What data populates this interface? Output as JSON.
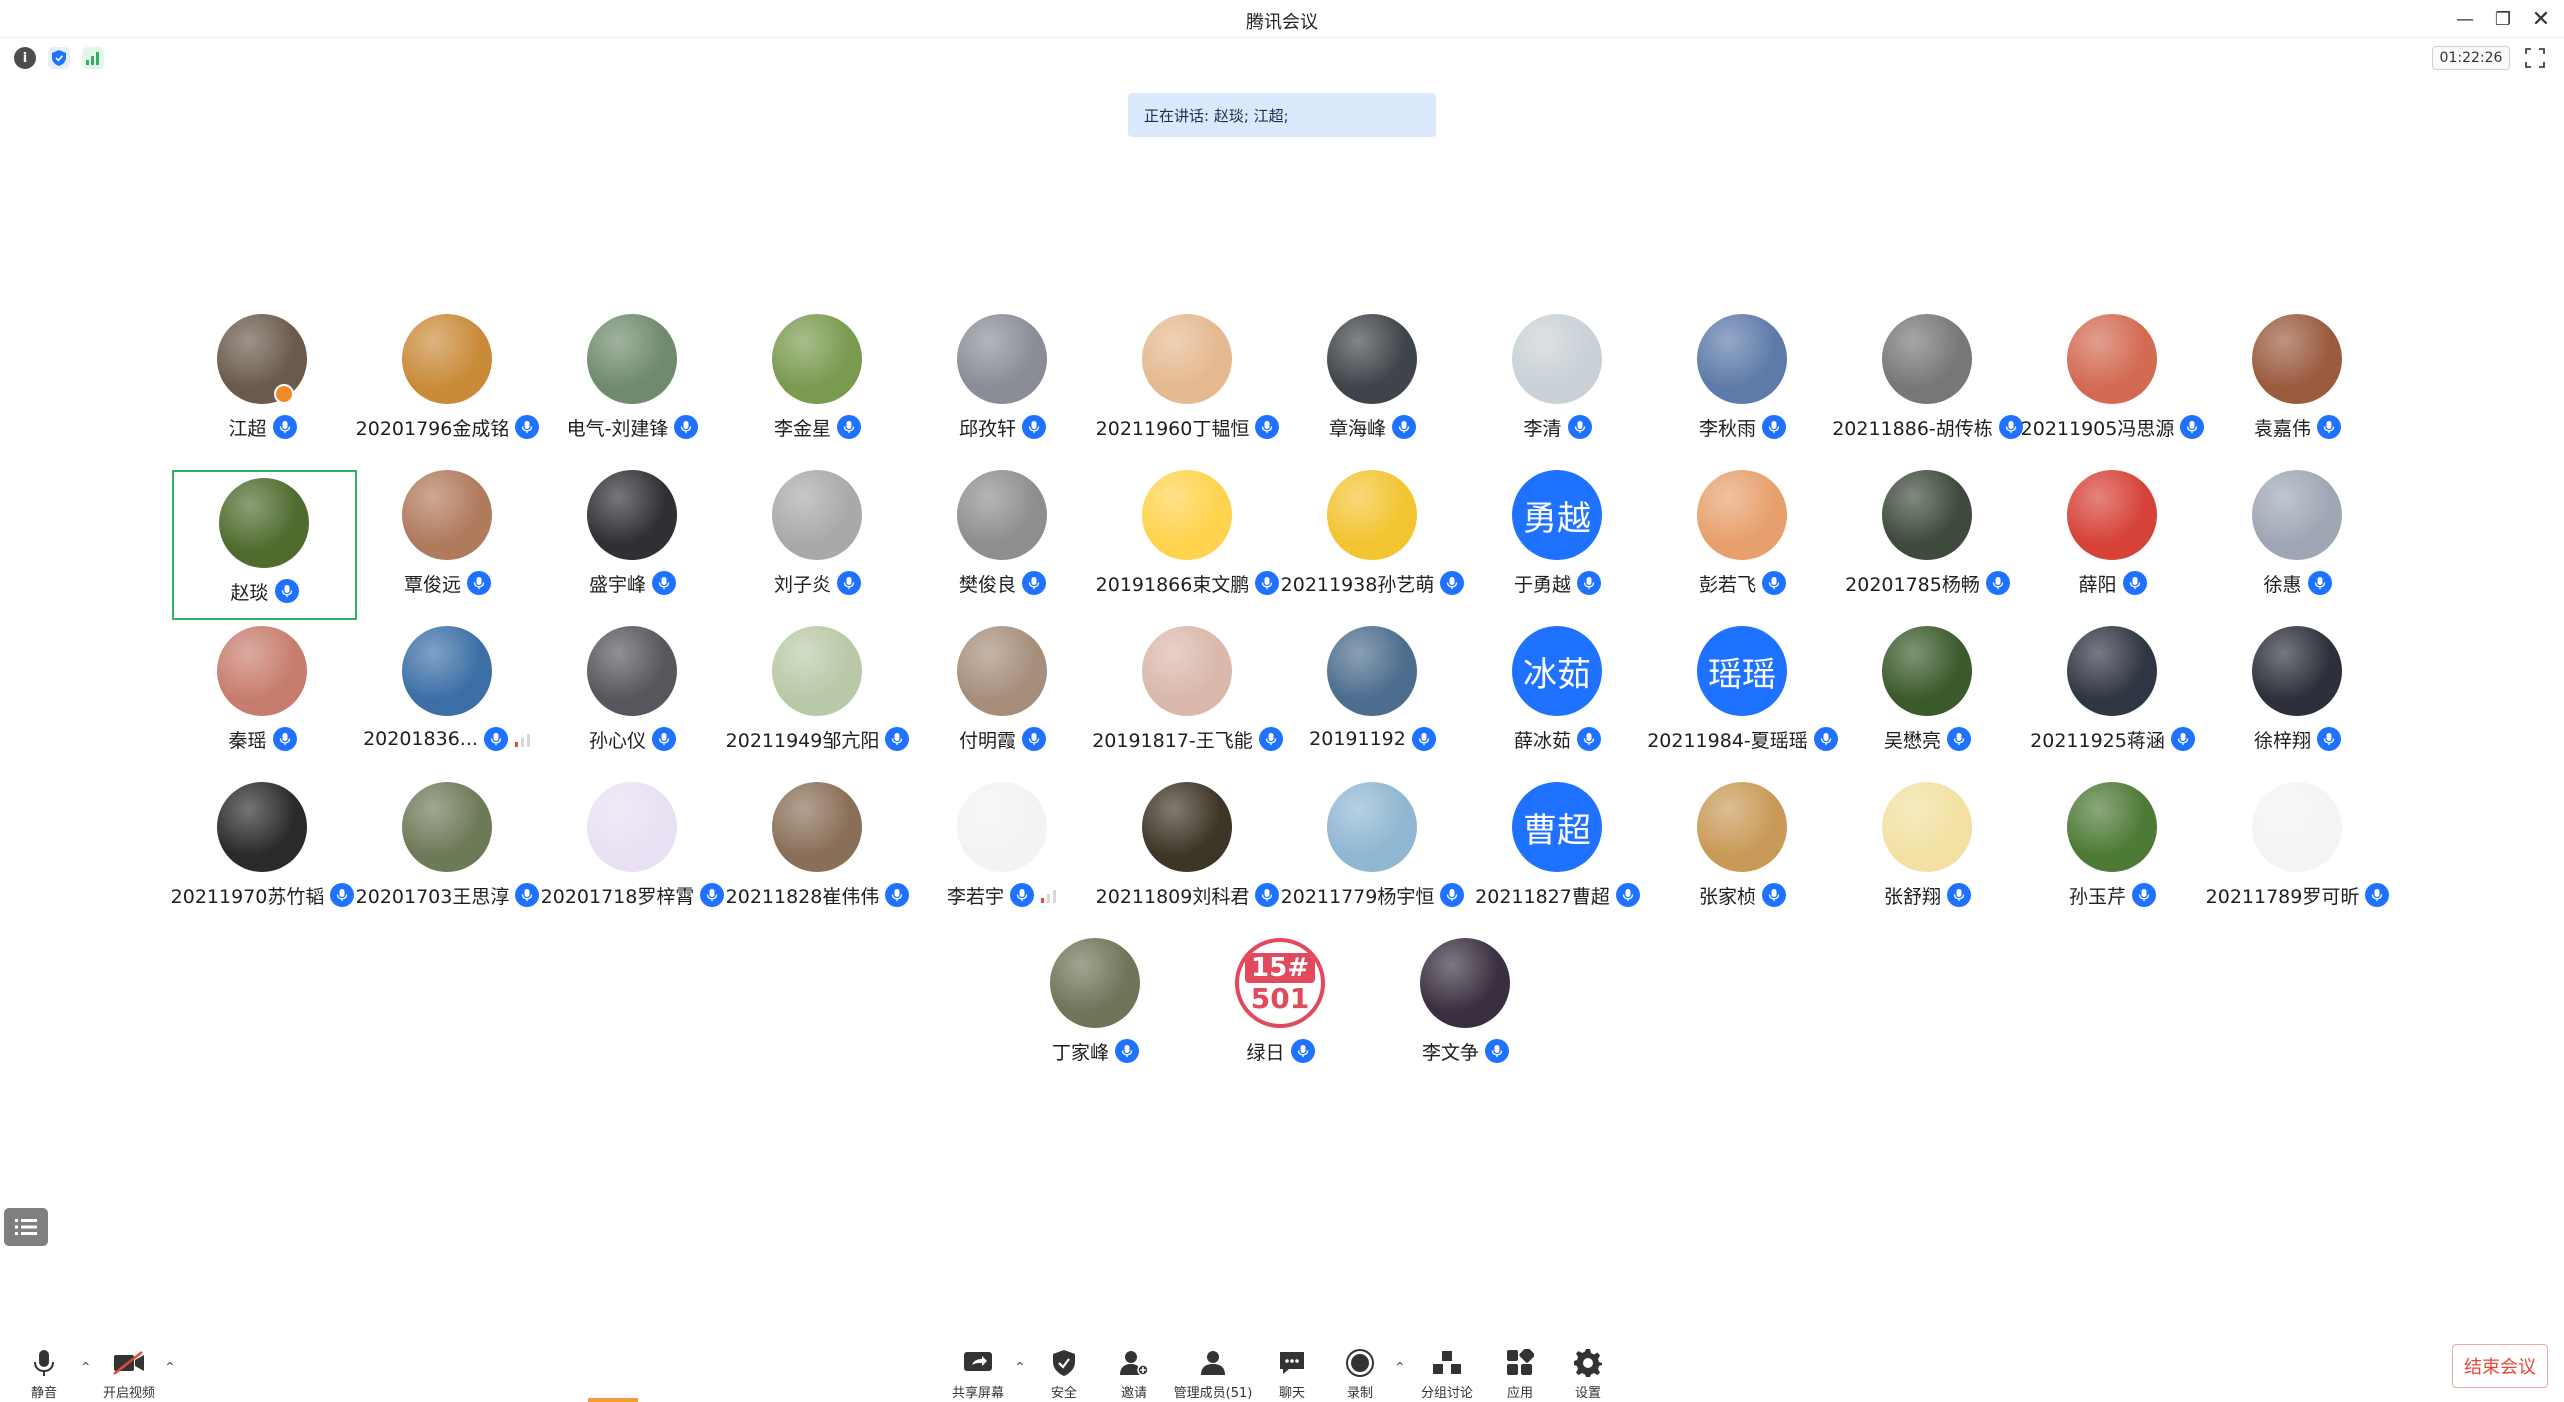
{
  "window": {
    "title": "腾讯会议",
    "minimize_icon": "minimize-icon",
    "restore_icon": "restore-icon",
    "close_icon": "close-icon"
  },
  "infobar": {
    "timer": "01:22:26"
  },
  "speaking_banner": "正在讲话: 赵琰; 江超;",
  "participants": [
    {
      "name": "江超",
      "avatar": "photo",
      "color": "#6a5a4c",
      "host": true
    },
    {
      "name": "20201796金成铭",
      "avatar": "photo",
      "color": "#c98b3a"
    },
    {
      "name": "电气-刘建锋",
      "avatar": "photo",
      "color": "#6f8a6c"
    },
    {
      "name": "李金星",
      "avatar": "photo",
      "color": "#7a9a4f"
    },
    {
      "name": "邱孜轩",
      "avatar": "photo",
      "color": "#8a8d96"
    },
    {
      "name": "20211960丁韫恒",
      "avatar": "photo",
      "color": "#e5b98f"
    },
    {
      "name": "章海峰",
      "avatar": "photo",
      "color": "#3f444a"
    },
    {
      "name": "李清",
      "avatar": "photo",
      "color": "#c9d1d6"
    },
    {
      "name": "李秋雨",
      "avatar": "photo",
      "color": "#5d7aa8"
    },
    {
      "name": "20211886-胡传栋",
      "avatar": "photo",
      "color": "#777777"
    },
    {
      "name": "20211905冯思源",
      "avatar": "photo",
      "color": "#d36a52"
    },
    {
      "name": "袁嘉伟",
      "avatar": "photo",
      "color": "#9a5b3e"
    },
    {
      "name": "赵琰",
      "avatar": "photo",
      "color": "#4f6b2d",
      "active": true
    },
    {
      "name": "覃俊远",
      "avatar": "photo",
      "color": "#b07a5c"
    },
    {
      "name": "盛宇峰",
      "avatar": "photo",
      "color": "#2f2f35"
    },
    {
      "name": "刘子炎",
      "avatar": "photo",
      "color": "#a9a9a9"
    },
    {
      "name": "樊俊良",
      "avatar": "photo",
      "color": "#8e8e8e"
    },
    {
      "name": "20191866束文鹏",
      "avatar": "photo",
      "color": "#ffd34d"
    },
    {
      "name": "20211938孙艺萌",
      "avatar": "photo",
      "color": "#f3c431"
    },
    {
      "name": "于勇越",
      "avatar": "text",
      "text": "勇越"
    },
    {
      "name": "彭若飞",
      "avatar": "photo",
      "color": "#e7a06d"
    },
    {
      "name": "20201785杨畅",
      "avatar": "photo",
      "color": "#3e4a3c"
    },
    {
      "name": "薛阳",
      "avatar": "photo",
      "color": "#d64238"
    },
    {
      "name": "徐惠",
      "avatar": "photo",
      "color": "#9fa7b5"
    },
    {
      "name": "秦瑶",
      "avatar": "photo",
      "color": "#c77d6d"
    },
    {
      "name": "20201836...",
      "avatar": "photo",
      "color": "#3c6fa6",
      "signal": true
    },
    {
      "name": "孙心仪",
      "avatar": "photo",
      "color": "#55575c"
    },
    {
      "name": "20211949邹亢阳",
      "avatar": "photo",
      "color": "#b9c9a7"
    },
    {
      "name": "付明霞",
      "avatar": "photo",
      "color": "#a68e7b"
    },
    {
      "name": "20191817-王飞能",
      "avatar": "photo",
      "color": "#d9b8ab"
    },
    {
      "name": "20191192",
      "avatar": "photo",
      "color": "#4c6d8e"
    },
    {
      "name": "薛冰茹",
      "avatar": "text",
      "text": "冰茹"
    },
    {
      "name": "20211984-夏瑶瑶",
      "avatar": "text",
      "text": "瑶瑶"
    },
    {
      "name": "吴懋亮",
      "avatar": "photo",
      "color": "#3b5a2b"
    },
    {
      "name": "20211925蒋涵",
      "avatar": "photo",
      "color": "#2f3542"
    },
    {
      "name": "徐梓翔",
      "avatar": "photo",
      "color": "#2d2f3a"
    },
    {
      "name": "20211970苏竹韬",
      "avatar": "photo",
      "color": "#2a2a2a"
    },
    {
      "name": "20201703王思淳",
      "avatar": "photo",
      "color": "#6d7a57"
    },
    {
      "name": "20201718罗梓霄",
      "avatar": "photo",
      "color": "#e9e1f3"
    },
    {
      "name": "20211828崔伟伟",
      "avatar": "photo",
      "color": "#8a6f58"
    },
    {
      "name": "李若宇",
      "avatar": "photo",
      "color": "#f3f3f3",
      "signal": true
    },
    {
      "name": "20211809刘科君",
      "avatar": "photo",
      "color": "#3d3526"
    },
    {
      "name": "20211779杨宇恒",
      "avatar": "photo",
      "color": "#8fb7d1"
    },
    {
      "name": "20211827曹超",
      "avatar": "text",
      "text": "曹超"
    },
    {
      "name": "张家桢",
      "avatar": "photo",
      "color": "#c99a57"
    },
    {
      "name": "张舒翔",
      "avatar": "photo",
      "color": "#f2e1a2"
    },
    {
      "name": "孙玉芹",
      "avatar": "photo",
      "color": "#4d7a35"
    },
    {
      "name": "20211789罗可昕",
      "avatar": "photo",
      "color": "#f4f4f4"
    },
    {
      "name": "丁家峰",
      "avatar": "photo",
      "color": "#6e7558"
    },
    {
      "name": "绿日",
      "avatar": "badge",
      "badge_top": "15#",
      "badge_bottom": "501",
      "color": "#e04a5c"
    },
    {
      "name": "李文争",
      "avatar": "photo",
      "color": "#3a2f3f"
    }
  ],
  "toolbar": {
    "mute": "静音",
    "video": "开启视频",
    "share": "共享屏幕",
    "security": "安全",
    "invite": "邀请",
    "members": "管理成员(51)",
    "chat": "聊天",
    "record": "录制",
    "breakout": "分组讨论",
    "apps": "应用",
    "settings": "设置",
    "end": "结束会议"
  },
  "colors": {
    "accent": "#1f72ff",
    "active_border": "#2fb067",
    "end": "#e5483b",
    "banner": "#dce8fb"
  }
}
